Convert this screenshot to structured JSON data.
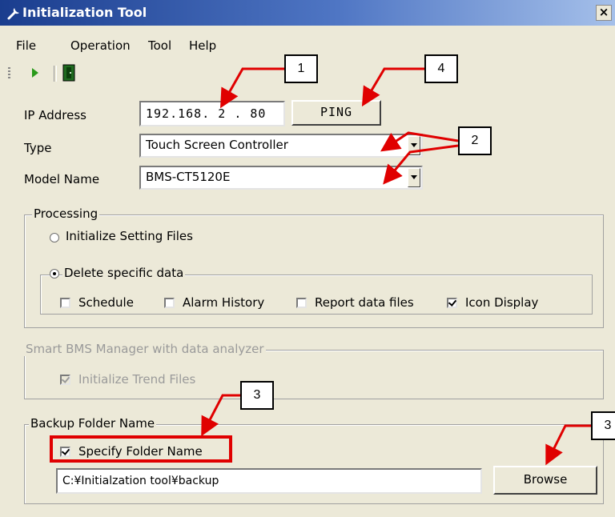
{
  "window": {
    "title": "Initialization Tool",
    "close_label": "×"
  },
  "menu": {
    "items": [
      "File",
      "Operation",
      "Tool",
      "Help"
    ]
  },
  "toolbar": {
    "icons": [
      "run-icon",
      "exit-icon"
    ]
  },
  "form": {
    "ip_label": "IP Address",
    "ip_value": "192.168. 2 . 80",
    "ping_label": "PING",
    "type_label": "Type",
    "type_value": "Touch Screen Controller",
    "model_label": "Model Name",
    "model_value": "BMS-CT5120E"
  },
  "processing": {
    "title": "Processing",
    "init_setting_files": "Initialize Setting Files",
    "delete_specific_data": "Delete specific data",
    "checks": [
      {
        "label": "Schedule",
        "checked": false
      },
      {
        "label": "Alarm History",
        "checked": false
      },
      {
        "label": "Report data files",
        "checked": false
      },
      {
        "label": "Icon Display",
        "checked": true
      }
    ]
  },
  "smart_bms": {
    "title": "Smart BMS Manager with data analyzer",
    "init_trend_files": "Initialize Trend Files"
  },
  "backup": {
    "title": "Backup Folder Name",
    "specify_folder": "Specify Folder Name",
    "path_value": "C:¥Initialzation tool¥backup",
    "browse_label": "Browse"
  },
  "callouts": [
    "1",
    "4",
    "2",
    "3",
    "3"
  ],
  "colors": {
    "callout_border": "#000000",
    "arrow": "#e00000",
    "title_bar": "#1a3d8e"
  }
}
